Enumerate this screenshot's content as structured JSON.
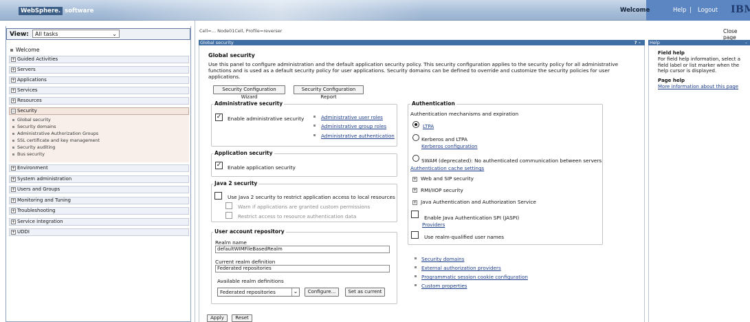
{
  "header": {
    "logo_box": "WebSphere.",
    "logo_text": "software",
    "welcome": "Welcome",
    "help": "Help",
    "separator": "|",
    "logout": "Logout",
    "ibm": "IBM"
  },
  "view": {
    "label": "View:",
    "selected": "All tasks"
  },
  "nav": {
    "welcome": "Welcome",
    "items": [
      "Guided Activities",
      "Servers",
      "Applications",
      "Services",
      "Resources",
      "Security",
      "Environment",
      "System administration",
      "Users and Groups",
      "Monitoring and Tuning",
      "Troubleshooting",
      "Service integration",
      "UDDI"
    ],
    "security_sub": [
      "Global security",
      "Security domains",
      "Administrative Authorization Groups",
      "SSL certificate and key management",
      "Security auditing",
      "Bus security"
    ]
  },
  "breadcrumb": "Cell=… Node01Cell, Profile=reverser",
  "close_page": "Close page",
  "panel": {
    "title": "Global security",
    "q": "? –",
    "heading": "Global security",
    "description": "Use this panel to configure administration and the default application security policy. This security configuration applies to the security policy for all administrative functions and is used as a default security policy for user applications. Security domains can be defined to override and customize the security policies for user applications.",
    "wizard_button": "Security Configuration Wizard",
    "report_button": "Security Configuration Report"
  },
  "admin_security": {
    "title": "Administrative security",
    "enable": "Enable administrative security",
    "checked": true,
    "links": [
      "Administrative user roles",
      "Administrative group roles",
      "Administrative authentication"
    ]
  },
  "app_security": {
    "title": "Application security",
    "enable": "Enable application security",
    "checked": true
  },
  "java2": {
    "title": "Java 2 security",
    "use": "Use Java 2 security to restrict application access to local resources",
    "warn": "Warn if applications are granted custom permissions",
    "restrict": "Restrict access to resource authentication data"
  },
  "user_repo": {
    "title": "User account repository",
    "realm_name_label": "Realm name",
    "realm_name": "defaultWIMFileBasedRealm",
    "current_label": "Current realm definition",
    "current": "Federated repositories",
    "available_label": "Available realm definitions",
    "available": "Federated repositories",
    "configure": "Configure...",
    "set_current": "Set as current"
  },
  "auth": {
    "title": "Authentication",
    "mechanisms": "Authentication mechanisms and expiration",
    "ltpa": "LTPA",
    "kerberos_ltpa": "Kerberos and LTPA",
    "kerberos_config": "Kerberos configuration",
    "swam": "SWAM (deprecated): No authenticated communication between servers",
    "cache": "Authentication cache settings",
    "web_sip": "Web and SIP security",
    "rmi": "RMI/IIOP security",
    "jaas": "Java Authentication and Authorization Service",
    "jaspi": "Enable Java Authentication SPI (JASPI)",
    "providers": "Providers",
    "realm_qualified": "Use realm-qualified user names"
  },
  "bottom_links": [
    "Security domains",
    "External authorization providers",
    "Programmatic session cookie configuration",
    "Custom properties"
  ],
  "actions": {
    "apply": "Apply",
    "reset": "Reset"
  },
  "help": {
    "title": "Help",
    "minus": "–",
    "field_help_title": "Field help",
    "field_help_text": "For field help information, select a field label or list marker when the help cursor is displayed.",
    "page_help_title": "Page help",
    "more_info": "More information about this page"
  }
}
